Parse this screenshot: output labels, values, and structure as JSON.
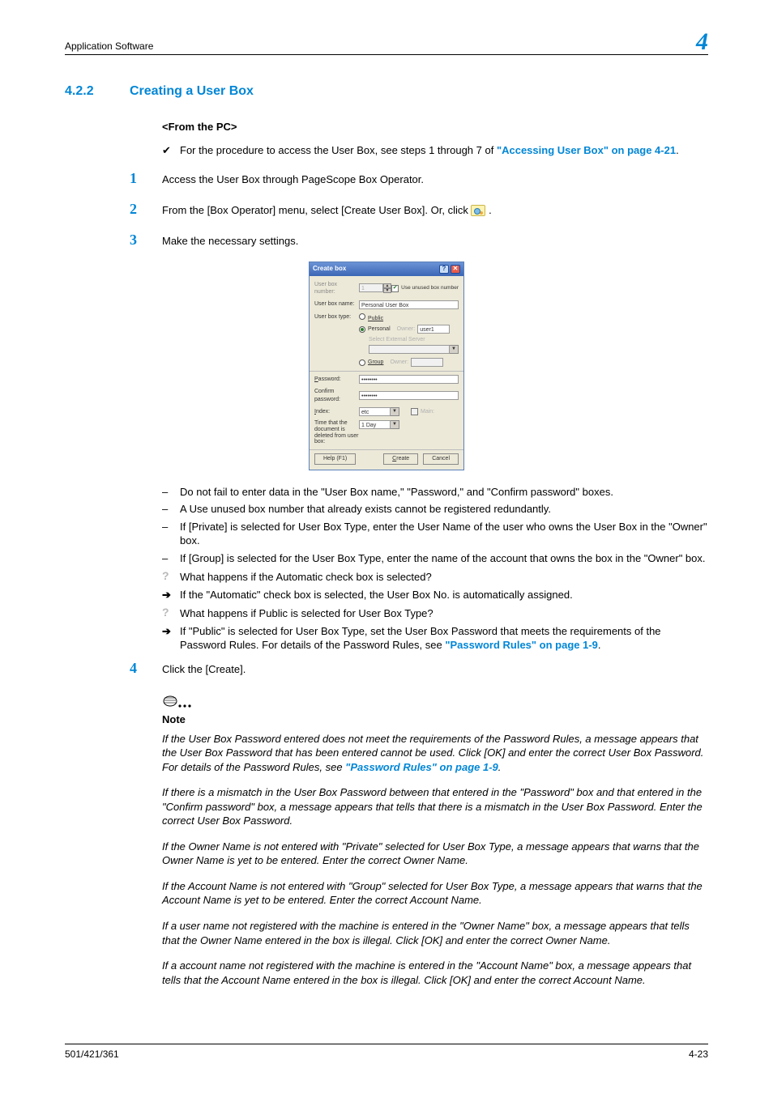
{
  "header": {
    "section": "Application Software",
    "chapter": "4"
  },
  "heading": {
    "number": "4.2.2",
    "title": "Creating a User Box"
  },
  "subhead": "<From the PC>",
  "intro": {
    "pre": "For the procedure to access the User Box, see steps 1 through 7 of ",
    "link": "\"Accessing User Box\" on page 4-21",
    "post": "."
  },
  "steps": {
    "s1": "Access the User Box through PageScope Box Operator.",
    "s2a": "From the [Box Operator] menu, select [Create User Box]. Or, click ",
    "s2b": " .",
    "s3": "Make the necessary settings.",
    "s4": "Click the [Create]."
  },
  "dialog": {
    "title": "Create box",
    "userbox_number_label": "User box number:",
    "use_unused_label": "Use unused box number",
    "userbox_name_label": "User box name:",
    "userbox_name_value": "Personal User Box",
    "userbox_type_label": "User box type:",
    "type_public": "Public",
    "type_personal": "Personal",
    "type_group": "Group",
    "owner_label": "Owner:",
    "owner_value": "user1",
    "select_external": "Select External Server",
    "password_label": "Password:",
    "confirm_label": "Confirm password:",
    "masked": "••••••••",
    "index_label": "Index:",
    "index_value": "etc",
    "main_label": "Main:",
    "time_label": "Time that the document is deleted from user box:",
    "time_value": "1 Day",
    "help_btn": "Help (F1)",
    "create_btn": "Create",
    "cancel_btn": "Cancel"
  },
  "notes3": {
    "d1": "Do not fail to enter data in the \"User Box name,\" \"Password,\" and \"Confirm password\" boxes.",
    "d2": "A Use unused box number that already exists cannot be registered redundantly.",
    "d3": "If [Private] is selected for User Box Type, enter the User Name of the user who owns the User Box in the \"Owner\" box.",
    "d4": "If [Group] is selected for the User Box Type, enter the name of the account that owns the box in the \"Owner\" box.",
    "q1": "What happens if the Automatic check box is selected?",
    "a1": "If the \"Automatic\" check box is selected, the User Box No. is automatically assigned.",
    "q2": "What happens if Public is selected for User Box Type?",
    "a2a": "If \"Public\" is selected for User Box Type, set the User Box Password that meets the requirements of the Password Rules. For details of the Password Rules, see ",
    "a2link": "\"Password Rules\" on page 1-9",
    "a2b": "."
  },
  "note": {
    "title": "Note",
    "p1a": "If the User Box Password entered does not meet the requirements of the Password Rules, a message appears that the User Box Password that has been entered cannot be used. Click [OK] and enter the correct User Box Password. For details of the Password Rules, see ",
    "p1link": "\"Password Rules\" on page 1-9",
    "p1b": ".",
    "p2": "If there is a mismatch in the User Box Password between that entered in the \"Password\" box and that entered in the \"Confirm password\" box, a message appears that tells that there is a mismatch in the User Box Password. Enter the correct User Box Password.",
    "p3": "If the Owner Name is not entered with \"Private\" selected for User Box Type, a message appears that warns that the Owner Name is yet to be entered. Enter the correct Owner Name.",
    "p4": "If the Account Name is not entered with \"Group\" selected for User Box Type, a message appears that warns that the Account Name is yet to be entered. Enter the correct Account Name.",
    "p5": "If a user name not registered with the machine is entered in the \"Owner Name\" box, a message appears that tells that the Owner Name entered in the box is illegal. Click [OK] and enter the correct Owner Name.",
    "p6": "If a account name not registered with the machine is entered in the \"Account Name\" box, a message appears that tells that the Account Name entered in the box is illegal. Click [OK] and enter the correct Account Name."
  },
  "footer": {
    "left": "501/421/361",
    "right": "4-23"
  }
}
